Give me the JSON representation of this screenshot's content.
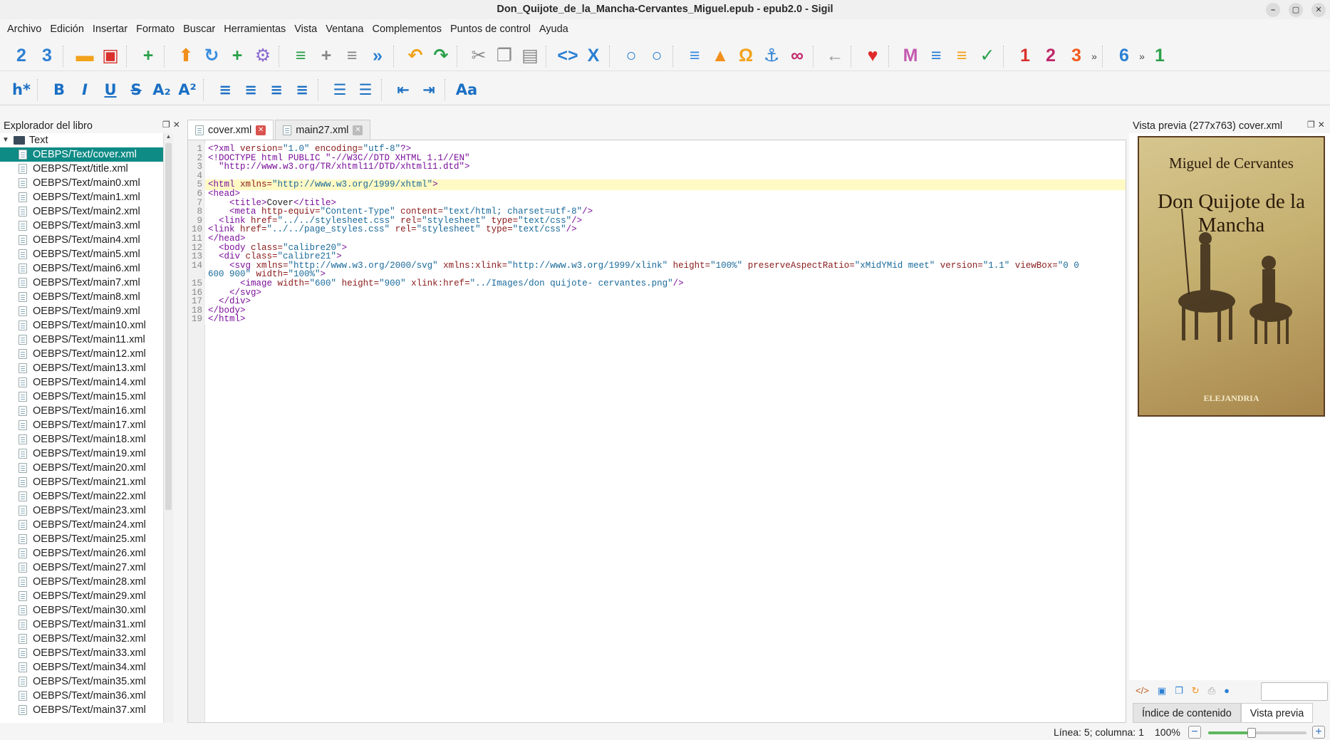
{
  "window": {
    "title": "Don_Quijote_de_la_Mancha-Cervantes_Miguel.epub - epub2.0 - Sigil"
  },
  "menu": [
    "Archivo",
    "Edición",
    "Insertar",
    "Formato",
    "Buscar",
    "Herramientas",
    "Vista",
    "Ventana",
    "Complementos",
    "Puntos de control",
    "Ayuda"
  ],
  "toolbar1": [
    {
      "name": "heading-2-icon",
      "glyph": "2",
      "color": "#2d7fd3"
    },
    {
      "name": "heading-3-icon",
      "glyph": "3",
      "color": "#2d7fd3"
    },
    {
      "name": "open-folder-icon",
      "glyph": "▬",
      "color": "#f2a21b"
    },
    {
      "name": "save-icon",
      "glyph": "▣",
      "color": "#d9302c"
    },
    {
      "name": "add-file-icon",
      "glyph": "+",
      "color": "#2aa04a"
    },
    {
      "name": "upload-icon",
      "glyph": "⬆",
      "color": "#f28f1b"
    },
    {
      "name": "reload-icon",
      "glyph": "↻",
      "color": "#3a8de0"
    },
    {
      "name": "add-plus-icon",
      "glyph": "+",
      "color": "#2aa04a"
    },
    {
      "name": "settings-gear-icon",
      "glyph": "⚙",
      "color": "#8a6ad0"
    },
    {
      "name": "merge-icon",
      "glyph": "≡",
      "color": "#2aa04a"
    },
    {
      "name": "split-icon",
      "glyph": "+",
      "color": "#888888"
    },
    {
      "name": "remove-icon",
      "glyph": "≡",
      "color": "#888888"
    },
    {
      "name": "reorder-icon",
      "glyph": "»",
      "color": "#2a7fd3"
    },
    {
      "name": "undo-icon",
      "glyph": "↶",
      "color": "#f2a21b"
    },
    {
      "name": "redo-icon",
      "glyph": "↷",
      "color": "#2aa04a"
    },
    {
      "name": "cut-icon",
      "glyph": "✂",
      "color": "#888888"
    },
    {
      "name": "copy-icon",
      "glyph": "❐",
      "color": "#888888"
    },
    {
      "name": "paste-icon",
      "glyph": "▤",
      "color": "#888888"
    },
    {
      "name": "code-tags-icon",
      "glyph": "<>",
      "color": "#2a7fd3"
    },
    {
      "name": "close-tags-icon",
      "glyph": "X",
      "color": "#2a7fd3"
    },
    {
      "name": "search-icon",
      "glyph": "○",
      "color": "#2a7fd3"
    },
    {
      "name": "search-favorite-icon",
      "glyph": "○",
      "color": "#2a7fd3"
    },
    {
      "name": "insert-file-icon",
      "glyph": "≡",
      "color": "#3a8de0"
    },
    {
      "name": "image-icon",
      "glyph": "▲",
      "color": "#f28f1b"
    },
    {
      "name": "omega-icon",
      "glyph": "Ω",
      "color": "#f2a21b"
    },
    {
      "name": "anchor-icon",
      "glyph": "⚓",
      "color": "#2a7fd3"
    },
    {
      "name": "link-icon",
      "glyph": "∞",
      "color": "#c0286a"
    },
    {
      "name": "back-arrow-icon",
      "glyph": "←",
      "color": "#999999"
    },
    {
      "name": "heart-icon",
      "glyph": "♥",
      "color": "#e02a2a"
    },
    {
      "name": "metadata-icon",
      "glyph": "M",
      "color": "#c45ab0"
    },
    {
      "name": "toc-icon",
      "glyph": "≡",
      "color": "#2a7fd3"
    },
    {
      "name": "toc-generate-icon",
      "glyph": "≡",
      "color": "#f2a21b"
    },
    {
      "name": "spellcheck-icon",
      "glyph": "✓",
      "color": "#2aa04a"
    },
    {
      "name": "plugin-1-icon",
      "glyph": "1",
      "color": "#d9302c"
    },
    {
      "name": "plugin-2-icon",
      "glyph": "2",
      "color": "#c0286a"
    },
    {
      "name": "plugin-3-icon",
      "glyph": "3",
      "color": "#f25a1b"
    },
    {
      "name": "plugin-6-icon",
      "glyph": "6",
      "color": "#2a7fd3"
    },
    {
      "name": "plugin-1b-icon",
      "glyph": "1",
      "color": "#2aa04a"
    }
  ],
  "toolbar1_more": "»",
  "toolbar2": [
    {
      "name": "heading-star-button",
      "glyph": "h*"
    },
    {
      "name": "bold-button",
      "glyph": "B"
    },
    {
      "name": "italic-button",
      "glyph": "I"
    },
    {
      "name": "underline-button",
      "glyph": "U"
    },
    {
      "name": "strikethrough-button",
      "glyph": "S"
    },
    {
      "name": "subscript-button",
      "glyph": "A₂"
    },
    {
      "name": "superscript-button",
      "glyph": "A²"
    },
    {
      "name": "align-left-button",
      "glyph": "≡"
    },
    {
      "name": "align-center-button",
      "glyph": "≡"
    },
    {
      "name": "align-right-button",
      "glyph": "≡"
    },
    {
      "name": "justify-button",
      "glyph": "≡"
    },
    {
      "name": "bullet-list-button",
      "glyph": "☰"
    },
    {
      "name": "numbered-list-button",
      "glyph": "☰"
    },
    {
      "name": "decrease-indent-button",
      "glyph": "⇤"
    },
    {
      "name": "increase-indent-button",
      "glyph": "⇥"
    },
    {
      "name": "text-case-button",
      "glyph": "Aa"
    }
  ],
  "explorer": {
    "title": "Explorador del libro",
    "folder": "Text",
    "files": [
      "OEBPS/Text/cover.xml",
      "OEBPS/Text/title.xml",
      "OEBPS/Text/main0.xml",
      "OEBPS/Text/main1.xml",
      "OEBPS/Text/main2.xml",
      "OEBPS/Text/main3.xml",
      "OEBPS/Text/main4.xml",
      "OEBPS/Text/main5.xml",
      "OEBPS/Text/main6.xml",
      "OEBPS/Text/main7.xml",
      "OEBPS/Text/main8.xml",
      "OEBPS/Text/main9.xml",
      "OEBPS/Text/main10.xml",
      "OEBPS/Text/main11.xml",
      "OEBPS/Text/main12.xml",
      "OEBPS/Text/main13.xml",
      "OEBPS/Text/main14.xml",
      "OEBPS/Text/main15.xml",
      "OEBPS/Text/main16.xml",
      "OEBPS/Text/main17.xml",
      "OEBPS/Text/main18.xml",
      "OEBPS/Text/main19.xml",
      "OEBPS/Text/main20.xml",
      "OEBPS/Text/main21.xml",
      "OEBPS/Text/main22.xml",
      "OEBPS/Text/main23.xml",
      "OEBPS/Text/main24.xml",
      "OEBPS/Text/main25.xml",
      "OEBPS/Text/main26.xml",
      "OEBPS/Text/main27.xml",
      "OEBPS/Text/main28.xml",
      "OEBPS/Text/main29.xml",
      "OEBPS/Text/main30.xml",
      "OEBPS/Text/main31.xml",
      "OEBPS/Text/main32.xml",
      "OEBPS/Text/main33.xml",
      "OEBPS/Text/main34.xml",
      "OEBPS/Text/main35.xml",
      "OEBPS/Text/main36.xml",
      "OEBPS/Text/main37.xml"
    ],
    "selected": "OEBPS/Text/cover.xml"
  },
  "tabs": [
    {
      "label": "cover.xml",
      "active": true
    },
    {
      "label": "main27.xml",
      "active": false
    }
  ],
  "code": {
    "highlight_line": 5,
    "lines": [
      {
        "n": "1",
        "parts": [
          [
            "t",
            "<?xml "
          ],
          [
            "a",
            "version="
          ],
          [
            "v",
            "\"1.0\" "
          ],
          [
            "a",
            "encoding="
          ],
          [
            "v",
            "\"utf-8\""
          ],
          [
            "t",
            "?>"
          ]
        ]
      },
      {
        "n": "2",
        "parts": [
          [
            "t",
            "<!DOCTYPE html PUBLIC \"-//W3C//DTD XHTML 1.1//EN\""
          ]
        ]
      },
      {
        "n": "3",
        "parts": [
          [
            "t",
            "  \"http://www.w3.org/TR/xhtml11/DTD/xhtml11.dtd\">"
          ]
        ]
      },
      {
        "n": "4",
        "parts": []
      },
      {
        "n": "5",
        "parts": [
          [
            "t",
            "<html "
          ],
          [
            "a",
            "xmlns="
          ],
          [
            "v",
            "\"http://www.w3.org/1999/xhtml\""
          ],
          [
            "t",
            ">"
          ]
        ]
      },
      {
        "n": "6",
        "parts": [
          [
            "t",
            "<head>"
          ]
        ]
      },
      {
        "n": "7",
        "parts": [
          [
            "c",
            "    "
          ],
          [
            "t",
            "<title>"
          ],
          [
            "c",
            "Cover"
          ],
          [
            "t",
            "</title>"
          ]
        ]
      },
      {
        "n": "8",
        "parts": [
          [
            "c",
            "    "
          ],
          [
            "t",
            "<meta "
          ],
          [
            "a",
            "http-equiv="
          ],
          [
            "v",
            "\"Content-Type\" "
          ],
          [
            "a",
            "content="
          ],
          [
            "v",
            "\"text/html; charset=utf-8\""
          ],
          [
            "t",
            "/>"
          ]
        ]
      },
      {
        "n": "9",
        "parts": [
          [
            "c",
            "  "
          ],
          [
            "t",
            "<link "
          ],
          [
            "a",
            "href="
          ],
          [
            "v",
            "\"../../stylesheet.css\" "
          ],
          [
            "a",
            "rel="
          ],
          [
            "v",
            "\"stylesheet\" "
          ],
          [
            "a",
            "type="
          ],
          [
            "v",
            "\"text/css\""
          ],
          [
            "t",
            "/>"
          ]
        ]
      },
      {
        "n": "10",
        "parts": [
          [
            "t",
            "<link "
          ],
          [
            "a",
            "href="
          ],
          [
            "v",
            "\"../../page_styles.css\" "
          ],
          [
            "a",
            "rel="
          ],
          [
            "v",
            "\"stylesheet\" "
          ],
          [
            "a",
            "type="
          ],
          [
            "v",
            "\"text/css\""
          ],
          [
            "t",
            "/>"
          ]
        ]
      },
      {
        "n": "11",
        "parts": [
          [
            "t",
            "</head>"
          ]
        ]
      },
      {
        "n": "12",
        "parts": [
          [
            "c",
            "  "
          ],
          [
            "t",
            "<body "
          ],
          [
            "a",
            "class="
          ],
          [
            "v",
            "\"calibre20\""
          ],
          [
            "t",
            ">"
          ]
        ]
      },
      {
        "n": "13",
        "parts": [
          [
            "c",
            "  "
          ],
          [
            "t",
            "<div "
          ],
          [
            "a",
            "class="
          ],
          [
            "v",
            "\"calibre21\""
          ],
          [
            "t",
            ">"
          ]
        ]
      },
      {
        "n": "14",
        "parts": [
          [
            "c",
            "    "
          ],
          [
            "t",
            "<svg "
          ],
          [
            "a",
            "xmlns="
          ],
          [
            "v",
            "\"http://www.w3.org/2000/svg\" "
          ],
          [
            "a",
            "xmlns:xlink="
          ],
          [
            "v",
            "\"http://www.w3.org/1999/xlink\" "
          ],
          [
            "a",
            "height="
          ],
          [
            "v",
            "\"100%\" "
          ],
          [
            "a",
            "preserveAspectRatio="
          ],
          [
            "v",
            "\"xMidYMid meet\" "
          ],
          [
            "a",
            "version="
          ],
          [
            "v",
            "\"1.1\" "
          ],
          [
            "a",
            "viewBox="
          ],
          [
            "v",
            "\"0 0"
          ]
        ]
      },
      {
        "n": "",
        "parts": [
          [
            "v",
            "600 900\" "
          ],
          [
            "a",
            "width="
          ],
          [
            "v",
            "\"100%\""
          ],
          [
            "t",
            ">"
          ]
        ]
      },
      {
        "n": "15",
        "parts": [
          [
            "c",
            "      "
          ],
          [
            "t",
            "<image "
          ],
          [
            "a",
            "width="
          ],
          [
            "v",
            "\"600\" "
          ],
          [
            "a",
            "height="
          ],
          [
            "v",
            "\"900\" "
          ],
          [
            "a",
            "xlink:href="
          ],
          [
            "v",
            "\"../Images/don quijote- cervantes.png\""
          ],
          [
            "t",
            "/>"
          ]
        ]
      },
      {
        "n": "16",
        "parts": [
          [
            "c",
            "    "
          ],
          [
            "t",
            "</svg>"
          ]
        ]
      },
      {
        "n": "17",
        "parts": [
          [
            "c",
            "  "
          ],
          [
            "t",
            "</div>"
          ]
        ]
      },
      {
        "n": "18",
        "parts": [
          [
            "t",
            "</body>"
          ]
        ]
      },
      {
        "n": "19",
        "parts": [
          [
            "t",
            "</html>"
          ]
        ]
      }
    ]
  },
  "preview": {
    "title": "Vista previa (277x763) cover.xml",
    "cover_author": "Miguel de Cervantes",
    "cover_title": "Don Quijote de la Mancha",
    "cover_publisher": "ELEJANDRIA"
  },
  "bottom_tabs": [
    "Índice de contenido",
    "Vista previa"
  ],
  "status": {
    "position": "Línea: 5; columna: 1",
    "zoom": "100%",
    "zoom_fraction": 0.44
  }
}
